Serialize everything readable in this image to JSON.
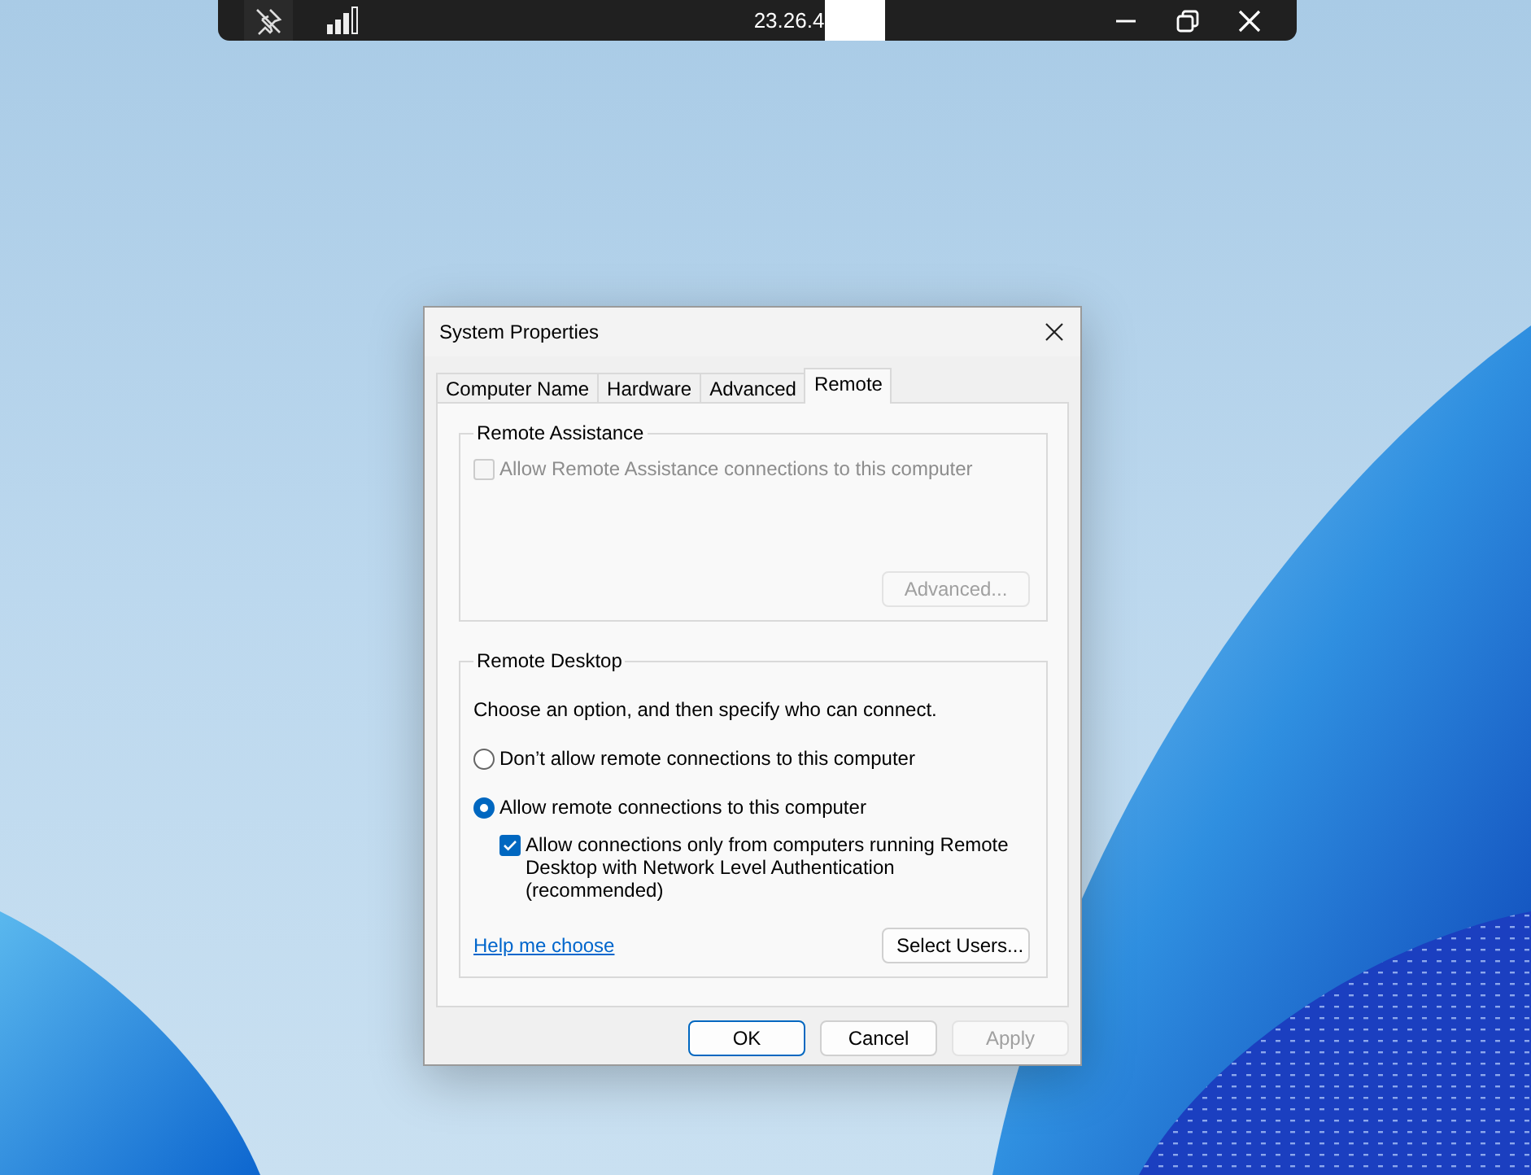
{
  "connection_bar": {
    "title": "23.26.4"
  },
  "dialog": {
    "title": "System Properties",
    "tabs": [
      {
        "label": "Computer Name",
        "selected": false
      },
      {
        "label": "Hardware",
        "selected": false
      },
      {
        "label": "Advanced",
        "selected": false
      },
      {
        "label": "Remote",
        "selected": true
      }
    ],
    "remote_assistance": {
      "title": "Remote Assistance",
      "checkbox": {
        "label": "Allow Remote Assistance connections to this computer",
        "checked": false,
        "disabled": true
      },
      "button": {
        "label": "Advanced...",
        "disabled": true
      }
    },
    "remote_desktop": {
      "title": "Remote Desktop",
      "instructions": "Choose an option, and then specify who can connect.",
      "options": [
        {
          "label": "Don’t allow remote connections to this computer",
          "selected": false
        },
        {
          "label": "Allow remote connections to this computer",
          "selected": true
        }
      ],
      "nla_checkbox": {
        "label": "Allow connections only from computers running Remote Desktop with Network Level Authentication (recommended)",
        "checked": true,
        "disabled": false
      },
      "help_link": "Help me choose",
      "button": {
        "label": "Select Users...",
        "disabled": false
      }
    },
    "buttons": [
      {
        "label": "OK",
        "default": true,
        "disabled": false
      },
      {
        "label": "Cancel",
        "default": false,
        "disabled": false
      },
      {
        "label": "Apply",
        "default": false,
        "disabled": true
      }
    ]
  }
}
